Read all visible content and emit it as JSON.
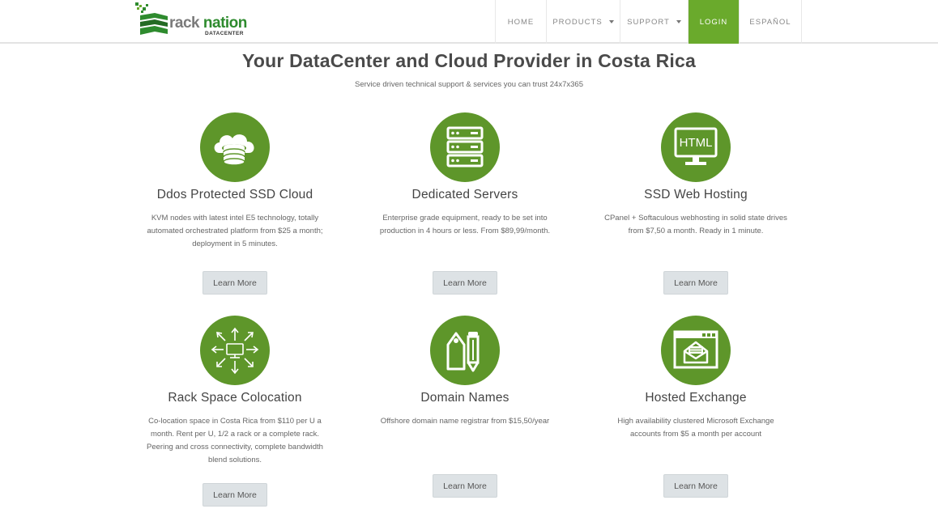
{
  "brand": {
    "name_part1": "rack",
    "name_part2": "nation",
    "subtitle": "DATACENTER",
    "colors": {
      "primary_green": "#5e962a",
      "nav_active": "#6aaa2c",
      "logo_green": "#2e8b2e"
    }
  },
  "nav": {
    "items": [
      {
        "label": "HOME"
      },
      {
        "label": "PRODUCTS"
      },
      {
        "label": "SUPPORT"
      },
      {
        "label": "LOGIN"
      },
      {
        "label": "ESPAÑOL"
      }
    ]
  },
  "hero": {
    "title": "Your DataCenter and Cloud Provider in Costa Rica",
    "subtitle": "Service driven technical support & services you can trust 24x7x365"
  },
  "services": [
    {
      "icon": "cloud-storage-icon",
      "title": "Ddos Protected SSD Cloud",
      "description": "KVM nodes with latest intel E5 technology, totally automated orchestrated platform from $25 a month; deployment in 5 minutes.",
      "button": "Learn More"
    },
    {
      "icon": "server-rack-icon",
      "title": "Dedicated Servers",
      "description": "Enterprise grade equipment, ready to be set into production in 4 hours or less. From $89,99/month.",
      "button": "Learn More"
    },
    {
      "icon": "html-monitor-icon",
      "icon_text": "HTML",
      "title": "SSD Web Hosting",
      "description": "CPanel + Softaculous webhosting in solid state drives from $7,50 a month. Ready in 1 minute.",
      "button": "Learn More"
    },
    {
      "icon": "network-arrows-icon",
      "title": "Rack Space Colocation",
      "description": "Co-location space in Costa Rica from $110 per U a month. Rent per U, 1/2 a rack or a complete rack. Peering and cross connectivity, complete bandwidth blend solutions.",
      "button": "Learn More"
    },
    {
      "icon": "tag-pencil-icon",
      "title": "Domain Names",
      "description": "Offshore domain name registrar from $15,50/year",
      "button": "Learn More"
    },
    {
      "icon": "email-window-icon",
      "title": "Hosted Exchange",
      "description": "High availability clustered Microsoft Exchange accounts from $5 a month per account",
      "button": "Learn More"
    }
  ]
}
